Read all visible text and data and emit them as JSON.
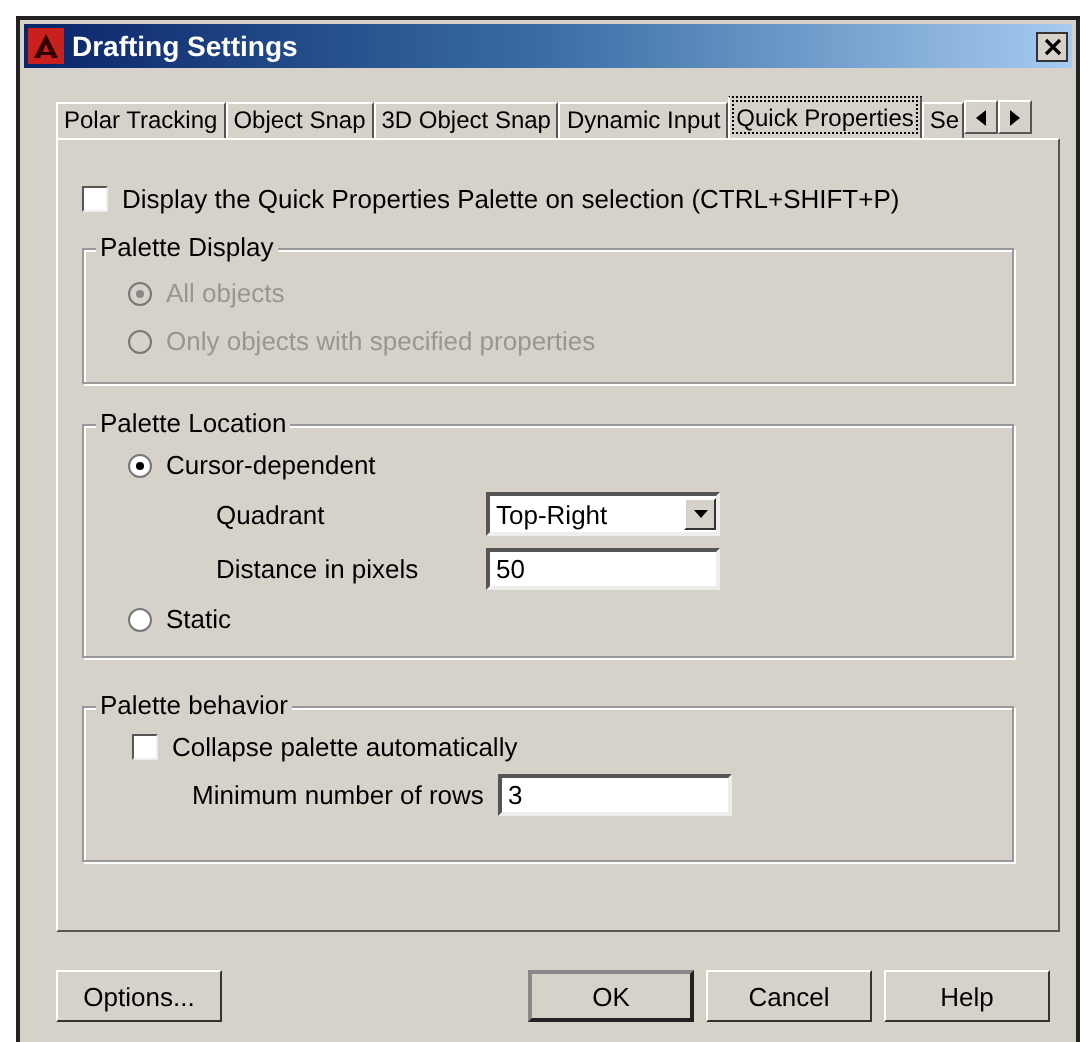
{
  "window": {
    "title": "Drafting Settings"
  },
  "tabs": [
    {
      "label": "Polar Tracking",
      "selected": false
    },
    {
      "label": "Object Snap",
      "selected": false
    },
    {
      "label": "3D Object Snap",
      "selected": false
    },
    {
      "label": "Dynamic Input",
      "selected": false
    },
    {
      "label": "Quick Properties",
      "selected": true
    },
    {
      "label": "Se",
      "selected": false
    }
  ],
  "display_palette": {
    "label": "Display the Quick Properties Palette on selection (CTRL+SHIFT+P)",
    "checked": false
  },
  "palette_display": {
    "title": "Palette Display",
    "disabled": true,
    "options": [
      {
        "label": "All objects",
        "selected": true
      },
      {
        "label": "Only objects with specified properties",
        "selected": false
      }
    ]
  },
  "palette_location": {
    "title": "Palette Location",
    "cursor_dependent": {
      "label": "Cursor-dependent",
      "selected": true
    },
    "quadrant": {
      "label": "Quadrant",
      "value": "Top-Right"
    },
    "distance": {
      "label": "Distance in pixels",
      "value": "50"
    },
    "static": {
      "label": "Static",
      "selected": false
    }
  },
  "palette_behavior": {
    "title": "Palette behavior",
    "collapse": {
      "label": "Collapse palette automatically",
      "checked": false
    },
    "min_rows": {
      "label": "Minimum number of rows",
      "value": "3"
    }
  },
  "buttons": [
    {
      "label": "Options...",
      "default": false
    },
    {
      "label": "OK",
      "default": true
    },
    {
      "label": "Cancel",
      "default": false
    },
    {
      "label": "Help",
      "default": false
    }
  ]
}
